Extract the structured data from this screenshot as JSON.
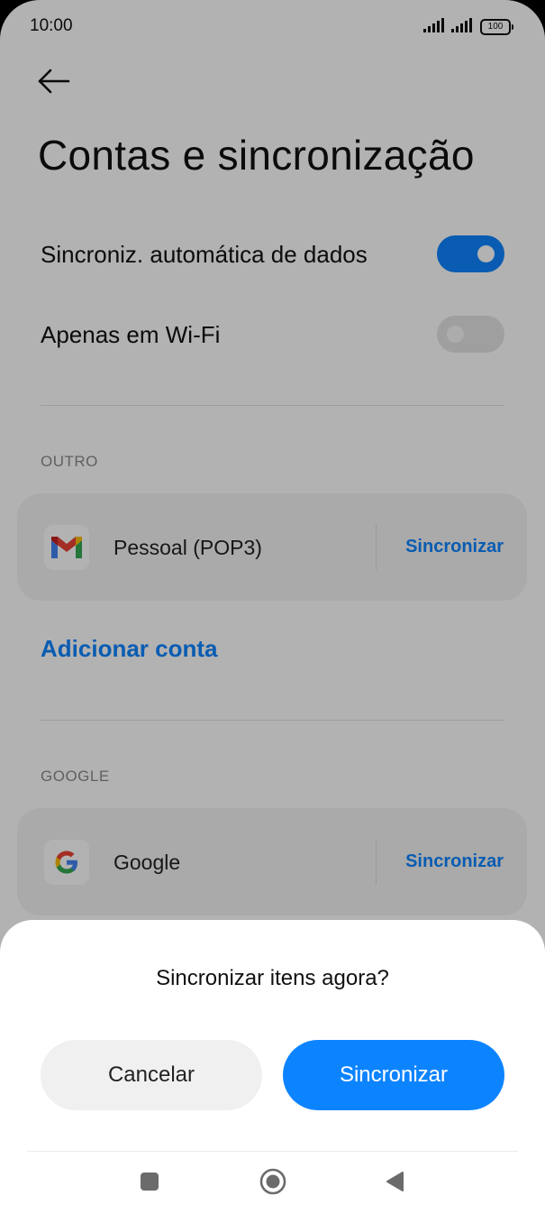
{
  "status_bar": {
    "time": "10:00",
    "battery": "100"
  },
  "page": {
    "title": "Contas e sincronização"
  },
  "settings": {
    "auto_sync": {
      "label": "Sincroniz. automática de dados",
      "enabled": true
    },
    "wifi_only": {
      "label": "Apenas em Wi-Fi",
      "enabled": false
    }
  },
  "sections": {
    "other": {
      "label": "OUTRO",
      "account": {
        "name": "Pessoal (POP3)",
        "icon": "gmail-icon",
        "action": "Sincronizar"
      },
      "add_account": "Adicionar conta"
    },
    "google": {
      "label": "GOOGLE",
      "account": {
        "name": "Google",
        "icon": "google-icon",
        "action": "Sincronizar"
      }
    }
  },
  "dialog": {
    "title": "Sincronizar itens agora?",
    "cancel_label": "Cancelar",
    "confirm_label": "Sincronizar"
  },
  "navbar": {
    "icons": [
      "recent-apps-icon",
      "home-icon",
      "back-icon"
    ]
  },
  "colors": {
    "accent": "#0d84ff",
    "scrim": "rgba(0,0,0,0.30)"
  }
}
